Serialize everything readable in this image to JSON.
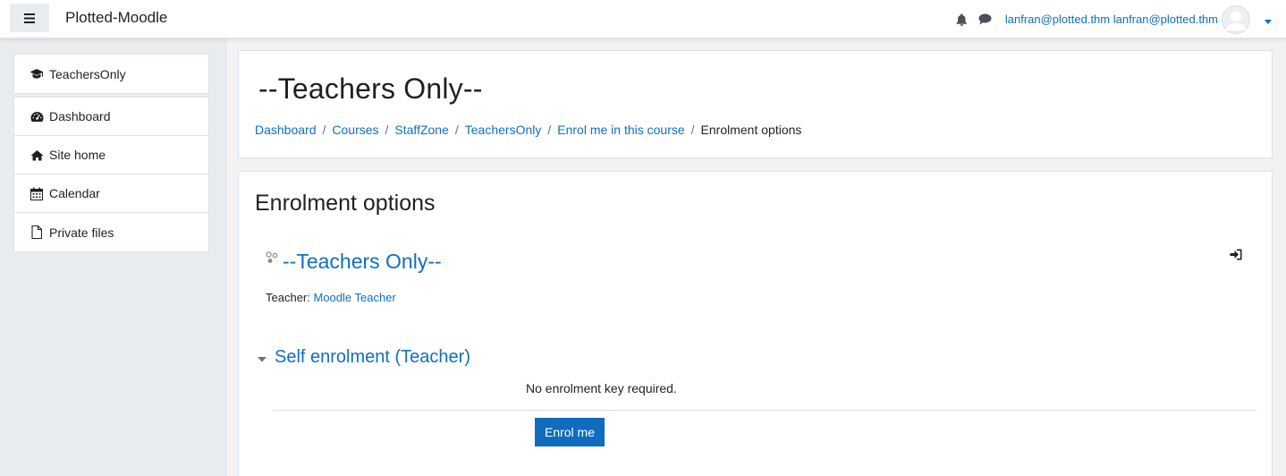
{
  "navbar": {
    "site_name": "Plotted-Moodle",
    "menu_icon": "hamburger-icon",
    "notification_icon": "bell-icon",
    "messages_icon": "chat-bubble-icon",
    "user_name": "lanfran@plotted.thm lanfran@plotted.thm",
    "user_menu_icon": "caret-down-icon"
  },
  "sidebar": {
    "course_item": {
      "label": "TeachersOnly",
      "icon": "graduation-cap-icon"
    },
    "items": [
      {
        "label": "Dashboard",
        "icon": "tachometer-icon"
      },
      {
        "label": "Site home",
        "icon": "home-icon"
      },
      {
        "label": "Calendar",
        "icon": "calendar-icon"
      },
      {
        "label": "Private files",
        "icon": "file-icon"
      }
    ]
  },
  "header": {
    "title": "--Teachers Only--",
    "breadcrumb": [
      "Dashboard",
      "Courses",
      "StaffZone",
      "TeachersOnly",
      "Enrol me in this course"
    ],
    "breadcrumb_current": "Enrolment options"
  },
  "main": {
    "section_title": "Enrolment options",
    "course_name": "--Teachers Only--",
    "teacher_label": "Teacher: ",
    "teacher_name": "Moodle Teacher",
    "self_enrol_title": "Self enrolment (Teacher)",
    "no_key_text": "No enrolment key required.",
    "enrol_button": "Enrol me"
  },
  "colors": {
    "link": "#0f6fc5",
    "primary_button": "#0f6cbf",
    "drawer_background": "#e9ecef"
  }
}
